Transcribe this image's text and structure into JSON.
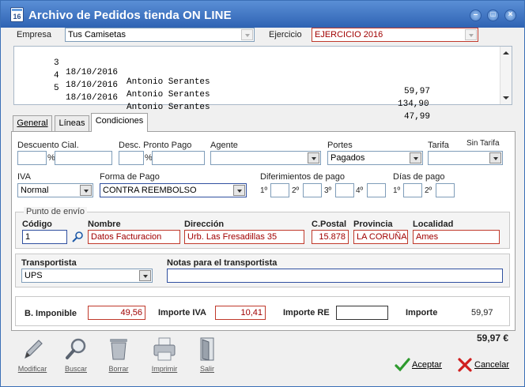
{
  "window": {
    "title": "Archivo de Pedidos tienda ON LINE",
    "icon_text": "16"
  },
  "header": {
    "empresa_label": "Empresa",
    "empresa_value": "Tus Camisetas",
    "ejercicio_label": "Ejercicio",
    "ejercicio_value": "EJERCICIO 2016"
  },
  "orders": [
    {
      "num": "3",
      "date": "18/10/2016",
      "client": "Antonio Serantes",
      "amount": "59,97"
    },
    {
      "num": "4",
      "date": "18/10/2016",
      "client": "Antonio Serantes",
      "amount": "134,90"
    },
    {
      "num": "5",
      "date": "18/10/2016",
      "client": "Antonio Serantes",
      "amount": "47,99"
    }
  ],
  "tabs": [
    {
      "label": "General"
    },
    {
      "label": "Líneas"
    },
    {
      "label": "Condiciones"
    }
  ],
  "conditions": {
    "descuento_label": "Descuento Cial.",
    "pct": "%",
    "pronto_label": "Desc. Pronto Pago",
    "agente_label": "Agente",
    "portes_label": "Portes",
    "portes_value": "Pagados",
    "tarifa_label": "Tarifa",
    "sin_tarifa": "Sin Tarifa",
    "iva_label": "IVA",
    "iva_value": "Normal",
    "forma_label": "Forma de Pago",
    "forma_value": "CONTRA REEMBOLSO",
    "diferimientos_label": "Diferimientos de pago",
    "dias_label": "Días de pago",
    "ord1": "1º",
    "ord2": "2º",
    "ord3": "3º",
    "ord4": "4º"
  },
  "envio": {
    "group_label": "Punto de envío",
    "codigo_label": "Código",
    "codigo_value": "1",
    "nombre_label": "Nombre",
    "nombre_value": "Datos Facturacion",
    "direccion_label": "Dirección",
    "direccion_value": "Urb. Las Fresadillas 35",
    "cpostal_label": "C.Postal",
    "cpostal_value": "15.878",
    "provincia_label": "Provincia",
    "provincia_value": "LA CORUÑA",
    "localidad_label": "Localidad",
    "localidad_value": "Ames"
  },
  "transporte": {
    "transportista_label": "Transportista",
    "transportista_value": "UPS",
    "notas_label": "Notas para el transportista",
    "notas_value": ""
  },
  "totales": {
    "base_label": "B. Imponible",
    "base_value": "49,56",
    "iva_label": "Importe IVA",
    "iva_value": "10,41",
    "re_label": "Importe RE",
    "re_value": "",
    "importe_label": "Importe",
    "importe_value": "59,97",
    "total_value": "59,97 €"
  },
  "toolbar": {
    "modificar": "Modificar",
    "buscar": "Buscar",
    "borrar": "Borrar",
    "imprimir": "Imprimir",
    "salir": "Salir",
    "aceptar": "Aceptar",
    "cancelar": "Cancelar"
  }
}
